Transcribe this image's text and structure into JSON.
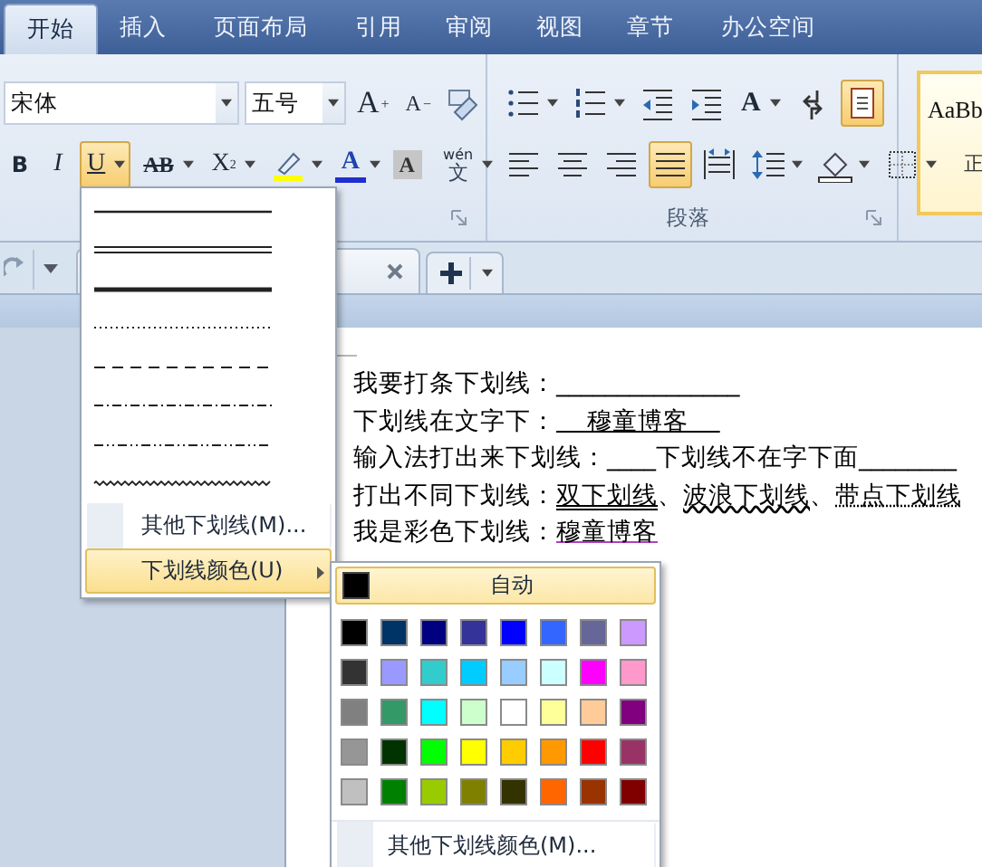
{
  "tabs": [
    {
      "label": "开始",
      "selected": true
    },
    {
      "label": "插入",
      "selected": false
    },
    {
      "label": "页面布局",
      "selected": false
    },
    {
      "label": "引用",
      "selected": false
    },
    {
      "label": "审阅",
      "selected": false
    },
    {
      "label": "视图",
      "selected": false
    },
    {
      "label": "章节",
      "selected": false
    },
    {
      "label": "办公空间",
      "selected": false
    }
  ],
  "font_group": {
    "font": "宋体",
    "size": "五号",
    "row1": [
      {
        "kind": "grow",
        "label": "A",
        "mark": "+"
      },
      {
        "kind": "shrink",
        "label": "A",
        "mark": "−"
      },
      {
        "kind": "clear"
      }
    ],
    "row2": [
      {
        "kind": "bold",
        "label": "B",
        "pressed": false,
        "dropdown": false
      },
      {
        "kind": "italic",
        "label": "I",
        "pressed": false,
        "dropdown": false
      },
      {
        "kind": "underline",
        "label": "U",
        "pressed": true,
        "dropdown": true
      },
      {
        "kind": "strike",
        "label": "AB",
        "pressed": false,
        "dropdown": true
      },
      {
        "kind": "superscript",
        "label": "X",
        "mark": "2",
        "pressed": false,
        "dropdown": true
      },
      {
        "kind": "highlight",
        "pressed": false,
        "dropdown": true
      },
      {
        "kind": "font-color",
        "label": "A",
        "pressed": false,
        "dropdown": true
      },
      {
        "kind": "shading",
        "label": "A",
        "pressed": false,
        "dropdown": false
      },
      {
        "kind": "phonetic",
        "label": "文",
        "mark": "wén",
        "pressed": false,
        "dropdown": true
      }
    ]
  },
  "paragraph_group": {
    "label": "段落",
    "row1": [
      {
        "kind": "bullets",
        "pressed": false,
        "dropdown": true
      },
      {
        "kind": "numbering",
        "pressed": false,
        "dropdown": true
      },
      {
        "kind": "outdent",
        "pressed": false,
        "dropdown": false
      },
      {
        "kind": "indent",
        "pressed": false,
        "dropdown": false
      },
      {
        "kind": "spacing",
        "label": "A",
        "pressed": false,
        "dropdown": true
      },
      {
        "kind": "marks",
        "pressed": false,
        "dropdown": false
      },
      {
        "kind": "frame",
        "pressed": true,
        "dropdown": false
      }
    ],
    "row2": [
      {
        "kind": "align-left",
        "pressed": false,
        "dropdown": false
      },
      {
        "kind": "align-center",
        "pressed": false,
        "dropdown": false
      },
      {
        "kind": "align-right",
        "pressed": false,
        "dropdown": false
      },
      {
        "kind": "justify",
        "pressed": true,
        "dropdown": false
      },
      {
        "kind": "distribute",
        "pressed": false,
        "dropdown": false
      },
      {
        "kind": "line-spacing",
        "pressed": false,
        "dropdown": true
      },
      {
        "kind": "fill",
        "pressed": false,
        "dropdown": true
      },
      {
        "kind": "borders",
        "pressed": false,
        "dropdown": true
      }
    ]
  },
  "styles": {
    "sample": "AaBb",
    "name": "正"
  },
  "document": {
    "lines": [
      {
        "segments": [
          {
            "kind": "plain",
            "text": "我要打条下划线：_______________"
          }
        ]
      },
      {
        "segments": [
          {
            "kind": "plain",
            "text": "下划线在文字下："
          },
          {
            "kind": "single",
            "text": "    穆童博客    "
          }
        ]
      },
      {
        "segments": [
          {
            "kind": "plain",
            "text": "输入法打出来下划线：____下划线不在字下面________"
          }
        ]
      },
      {
        "segments": [
          {
            "kind": "plain",
            "text": "打出不同下划线："
          },
          {
            "kind": "double",
            "text": "双下划线"
          },
          {
            "kind": "plain",
            "text": "、"
          },
          {
            "kind": "wavy",
            "text": "波浪下划线"
          },
          {
            "kind": "plain",
            "text": "、"
          },
          {
            "kind": "dotted",
            "text": "带点下划线"
          }
        ]
      },
      {
        "segments": [
          {
            "kind": "plain",
            "text": "我是彩色下划线："
          },
          {
            "kind": "single",
            "text": "穆童博客",
            "color": "#b040c0"
          }
        ]
      }
    ]
  },
  "underline_menu": {
    "styles": [
      {
        "kind": "single"
      },
      {
        "kind": "double"
      },
      {
        "kind": "thick"
      },
      {
        "kind": "dotted"
      },
      {
        "kind": "dashed"
      },
      {
        "kind": "dash-dot"
      },
      {
        "kind": "dash-dot-dot"
      },
      {
        "kind": "wave"
      }
    ],
    "items": [
      {
        "label": "其他下划线(M)...",
        "highlighted": false,
        "submenu": false
      },
      {
        "label": "下划线颜色(U)",
        "highlighted": true,
        "submenu": true
      }
    ]
  },
  "color_menu": {
    "auto": {
      "label": "自动",
      "color": "#000000",
      "highlighted": true
    },
    "colors": [
      {
        "color": "#000000"
      },
      {
        "color": "#003366"
      },
      {
        "color": "#000080"
      },
      {
        "color": "#333399"
      },
      {
        "color": "#0000ff"
      },
      {
        "color": "#3366ff"
      },
      {
        "color": "#666699"
      },
      {
        "color": "#cc99ff"
      },
      {
        "color": "#333333"
      },
      {
        "color": "#9999ff"
      },
      {
        "color": "#33cccc"
      },
      {
        "color": "#00ccff"
      },
      {
        "color": "#99ccff"
      },
      {
        "color": "#ccffff"
      },
      {
        "color": "#ff00ff"
      },
      {
        "color": "#ff99cc"
      },
      {
        "color": "#808080"
      },
      {
        "color": "#339966"
      },
      {
        "color": "#00ffff"
      },
      {
        "color": "#ccffcc"
      },
      {
        "color": "#ffffff"
      },
      {
        "color": "#ffff99"
      },
      {
        "color": "#ffcc99"
      },
      {
        "color": "#800080"
      },
      {
        "color": "#969696"
      },
      {
        "color": "#003300"
      },
      {
        "color": "#00ff00"
      },
      {
        "color": "#ffff00"
      },
      {
        "color": "#ffcc00"
      },
      {
        "color": "#ff9900"
      },
      {
        "color": "#ff0000"
      },
      {
        "color": "#993366"
      },
      {
        "color": "#c0c0c0"
      },
      {
        "color": "#008000"
      },
      {
        "color": "#99cc00"
      },
      {
        "color": "#808000"
      },
      {
        "color": "#333300"
      },
      {
        "color": "#ff6600"
      },
      {
        "color": "#993300"
      },
      {
        "color": "#800000"
      }
    ],
    "more": "其他下划线颜色(M)..."
  }
}
